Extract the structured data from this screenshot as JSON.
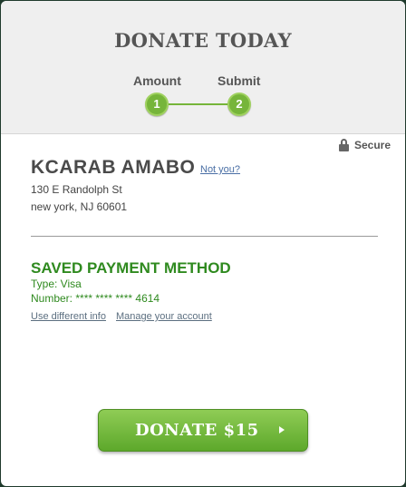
{
  "header": {
    "title": "DONATE TODAY",
    "steps": [
      {
        "label": "Amount",
        "number": "1"
      },
      {
        "label": "Submit",
        "number": "2"
      }
    ]
  },
  "secure": {
    "label": "Secure",
    "icon": "lock-icon"
  },
  "donor": {
    "name": "KCARAB AMABO",
    "not_you": "Not you?",
    "address_line1": "130 E Randolph St",
    "address_line2": "new york, NJ 60601"
  },
  "payment": {
    "heading": "SAVED PAYMENT METHOD",
    "type": "Type: Visa",
    "number": "Number: **** **** **** 4614",
    "use_different": "Use different info",
    "manage_account": "Manage your account"
  },
  "donate_button": {
    "label": "DONATE $15",
    "icon": "play-arrow-icon"
  },
  "colors": {
    "accent_green": "#76b53a",
    "heading_green": "#2f8a1f",
    "header_bg": "#efefef",
    "link_blue": "#4a6fa5"
  }
}
